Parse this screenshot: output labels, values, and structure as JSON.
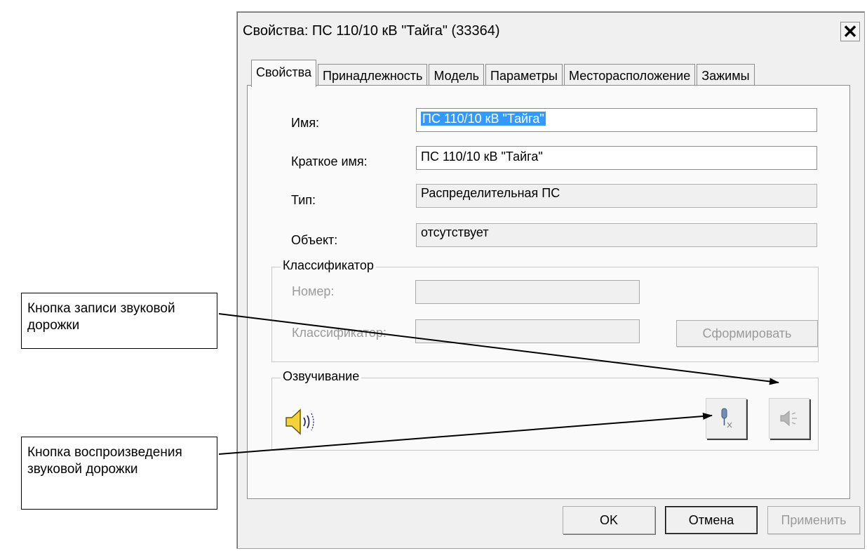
{
  "window": {
    "title": "Свойства: ПС 110/10 кВ \"Тайга\" (33364)",
    "close_label": "✕"
  },
  "tabs": [
    {
      "label": "Свойства",
      "active": true
    },
    {
      "label": "Принадлежность"
    },
    {
      "label": "Модель"
    },
    {
      "label": "Параметры"
    },
    {
      "label": "Месторасположение"
    },
    {
      "label": "Зажимы"
    }
  ],
  "fields": {
    "name": {
      "label": "Имя:",
      "value": "ПС 110/10 кВ \"Тайга\""
    },
    "short_name": {
      "label": "Краткое имя:",
      "value": "ПС 110/10 кВ \"Тайга\""
    },
    "type": {
      "label": "Тип:",
      "value": "Распределительная ПС"
    },
    "object": {
      "label": "Объект:",
      "value": "отсутствует"
    }
  },
  "classifier": {
    "title": "Классификатор",
    "number_label": "Номер:",
    "number_value": "",
    "classifier_label": "Классификатор:",
    "classifier_value": "",
    "form_button": "Сформировать"
  },
  "voicing": {
    "title": "Озвучивание"
  },
  "footer": {
    "ok": "OK",
    "cancel": "Отмена",
    "apply": "Применить"
  },
  "callouts": {
    "record": "Кнопка записи звуковой дорожки",
    "play": "Кнопка воспроизведения звуковой дорожки"
  }
}
